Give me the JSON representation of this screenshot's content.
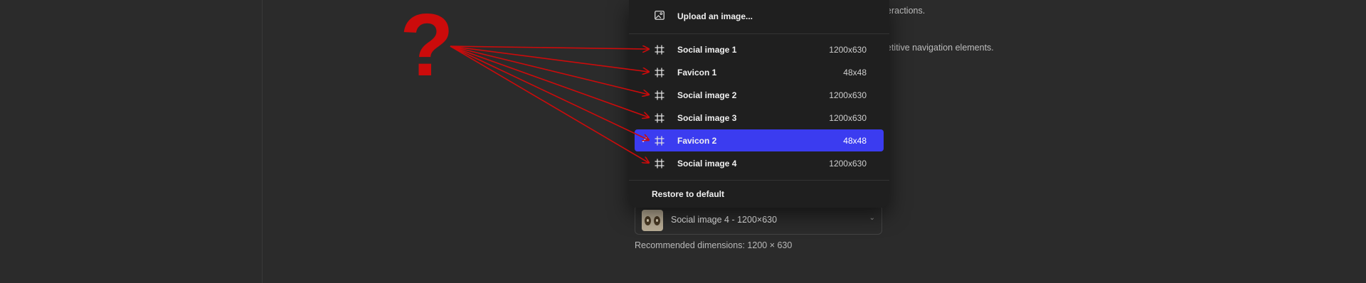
{
  "background_text": {
    "line1": "eractions.",
    "line2": "etitive navigation elements."
  },
  "menu": {
    "upload": {
      "label": "Upload an image...",
      "icon": "image-upload-icon"
    },
    "items": [
      {
        "label": "Social image 1",
        "size": "1200x630",
        "icon": "frame-icon",
        "selected": false
      },
      {
        "label": "Favicon 1",
        "size": "48x48",
        "icon": "frame-icon",
        "selected": false
      },
      {
        "label": "Social image 2",
        "size": "1200x630",
        "icon": "frame-icon",
        "selected": false
      },
      {
        "label": "Social image 3",
        "size": "1200x630",
        "icon": "frame-icon",
        "selected": false
      },
      {
        "label": "Favicon 2",
        "size": "48x48",
        "icon": "frame-icon",
        "selected": true,
        "check": "✓"
      },
      {
        "label": "Social image 4",
        "size": "1200x630",
        "icon": "frame-icon",
        "selected": false
      }
    ],
    "restore_label": "Restore to default",
    "selected_color": "#3b3cf0"
  },
  "select": {
    "value": "Social image 4 - 1200×630",
    "chevron": "⌄"
  },
  "hint": "Recommended dimensions: 1200 × 630",
  "annotation": {
    "symbol": "?",
    "color": "#cc0b0b"
  }
}
